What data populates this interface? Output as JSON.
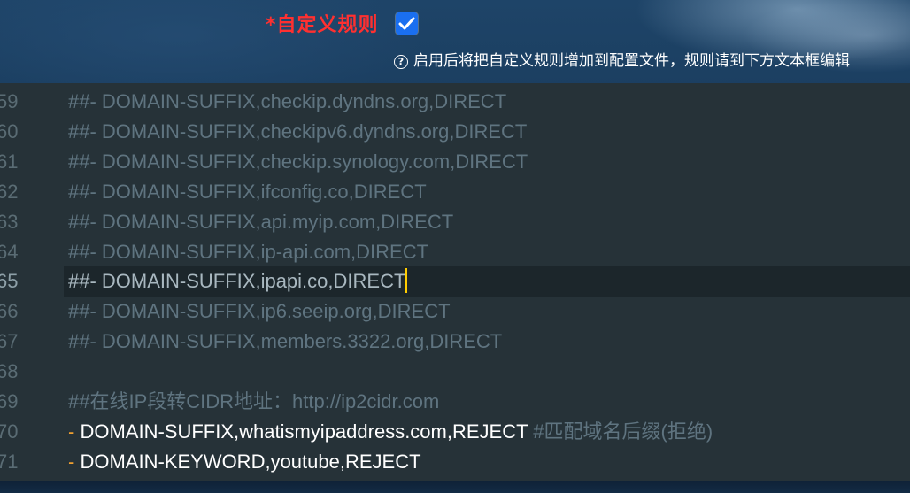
{
  "header": {
    "rule_label": "*自定义规则",
    "enabled": true,
    "help_text": "启用后将把自定义规则增加到配置文件，规则请到下方文本框编辑"
  },
  "editor": {
    "active_line": 65,
    "lines": [
      {
        "num": "59",
        "type": "comment",
        "text": "##- DOMAIN-SUFFIX,checkip.dyndns.org,DIRECT"
      },
      {
        "num": "60",
        "type": "comment",
        "text": "##- DOMAIN-SUFFIX,checkipv6.dyndns.org,DIRECT"
      },
      {
        "num": "61",
        "type": "comment",
        "text": "##- DOMAIN-SUFFIX,checkip.synology.com,DIRECT"
      },
      {
        "num": "62",
        "type": "comment",
        "text": "##- DOMAIN-SUFFIX,ifconfig.co,DIRECT"
      },
      {
        "num": "63",
        "type": "comment",
        "text": "##- DOMAIN-SUFFIX,api.myip.com,DIRECT"
      },
      {
        "num": "64",
        "type": "comment",
        "text": "##- DOMAIN-SUFFIX,ip-api.com,DIRECT"
      },
      {
        "num": "65",
        "type": "comment",
        "text": "##- DOMAIN-SUFFIX,ipapi.co,DIRECT"
      },
      {
        "num": "66",
        "type": "comment",
        "text": "##- DOMAIN-SUFFIX,ip6.seeip.org,DIRECT"
      },
      {
        "num": "67",
        "type": "comment",
        "text": "##- DOMAIN-SUFFIX,members.3322.org,DIRECT"
      },
      {
        "num": "68",
        "type": "empty",
        "text": ""
      },
      {
        "num": "69",
        "type": "comment",
        "text": "##在线IP段转CIDR地址：http://ip2cidr.com"
      },
      {
        "num": "70",
        "type": "rule",
        "dash": "-",
        "text": "DOMAIN-SUFFIX,whatismyipaddress.com,REJECT",
        "comment": "#匹配域名后缀(拒绝)"
      },
      {
        "num": "71",
        "type": "rule",
        "dash": "-",
        "text": "DOMAIN-KEYWORD,youtube,REJECT",
        "comment": ""
      }
    ]
  },
  "colors": {
    "label_red": "#ff3030",
    "checkbox_blue": "#1a6ff0",
    "editor_bg": "#263238",
    "comment": "#5f7480",
    "dash": "#f0a030",
    "cursor": "#ffcc00"
  }
}
